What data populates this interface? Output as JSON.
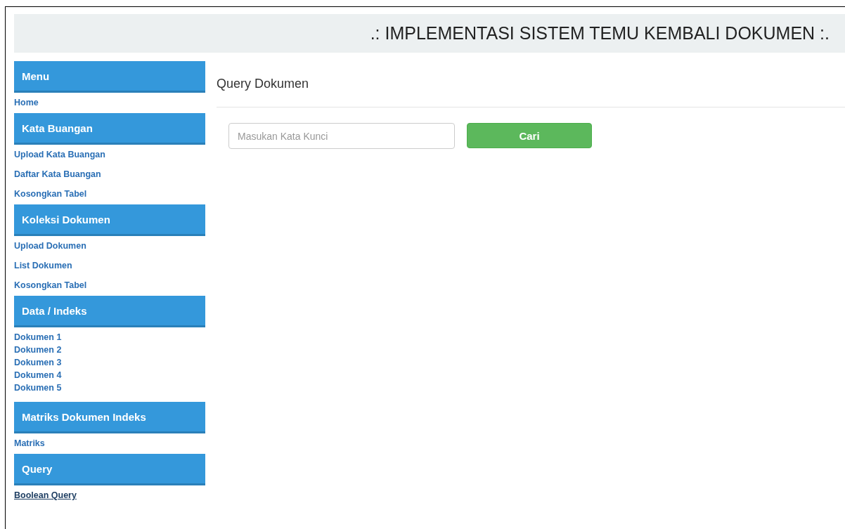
{
  "header": {
    "title": ".: IMPLEMENTASI SISTEM TEMU KEMBALI DOKUMEN :."
  },
  "sidebar": {
    "sections": [
      {
        "title": "Menu",
        "kind": "spaced",
        "items": [
          {
            "label": "Home",
            "selected": false
          }
        ]
      },
      {
        "title": "Kata Buangan",
        "kind": "spaced",
        "items": [
          {
            "label": "Upload Kata Buangan",
            "selected": false
          },
          {
            "label": "Daftar Kata Buangan",
            "selected": false
          },
          {
            "label": "Kosongkan Tabel",
            "selected": false
          }
        ]
      },
      {
        "title": "Koleksi Dokumen",
        "kind": "spaced",
        "items": [
          {
            "label": "Upload Dokumen",
            "selected": false
          },
          {
            "label": "List Dokumen",
            "selected": false
          },
          {
            "label": "Kosongkan Tabel",
            "selected": false
          }
        ]
      },
      {
        "title": "Data / Indeks",
        "kind": "compact",
        "items": [
          {
            "label": "Dokumen 1",
            "selected": false
          },
          {
            "label": "Dokumen 2",
            "selected": false
          },
          {
            "label": "Dokumen 3",
            "selected": false
          },
          {
            "label": "Dokumen 4",
            "selected": false
          },
          {
            "label": "Dokumen 5",
            "selected": false
          }
        ]
      },
      {
        "title": "Matriks Dokumen Indeks",
        "kind": "spaced",
        "items": [
          {
            "label": "Matriks",
            "selected": false
          }
        ]
      },
      {
        "title": "Query",
        "kind": "spaced",
        "items": [
          {
            "label": "Boolean Query",
            "selected": true
          }
        ]
      }
    ]
  },
  "main": {
    "title": "Query Dokumen",
    "search": {
      "placeholder": "Masukan Kata Kunci"
    },
    "button": "Cari"
  }
}
